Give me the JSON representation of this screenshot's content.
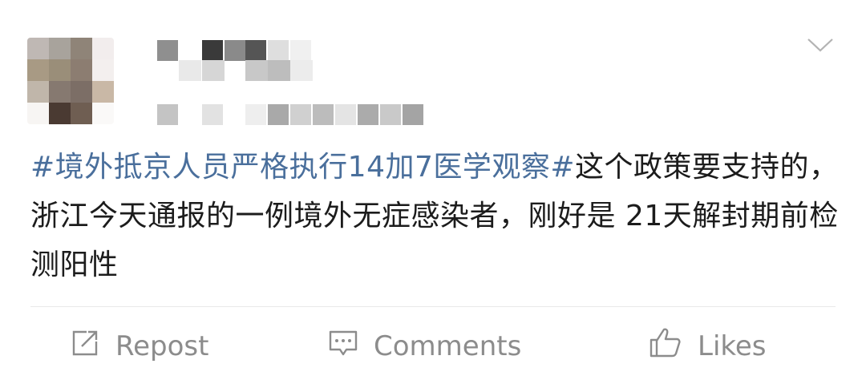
{
  "post": {
    "text": {
      "topic": "#境外抵京人员严格执行14加7医学观察#",
      "body": "这个政策要支持的，浙江今天通报的一例境外无症感染者，刚好是 21天解封期前检测阳性"
    },
    "actions": {
      "repost": "Repost",
      "comments": "Comments",
      "likes": "Likes"
    }
  },
  "icons": {
    "more": "chevron-down-icon",
    "repost": "repost-icon",
    "comments": "comment-icon",
    "likes": "thumbs-up-icon"
  },
  "colors": {
    "topic": "#4a6f9c",
    "text": "#1c1c1c",
    "action_text": "#8c8c8c",
    "divider": "#e9e9e9"
  }
}
